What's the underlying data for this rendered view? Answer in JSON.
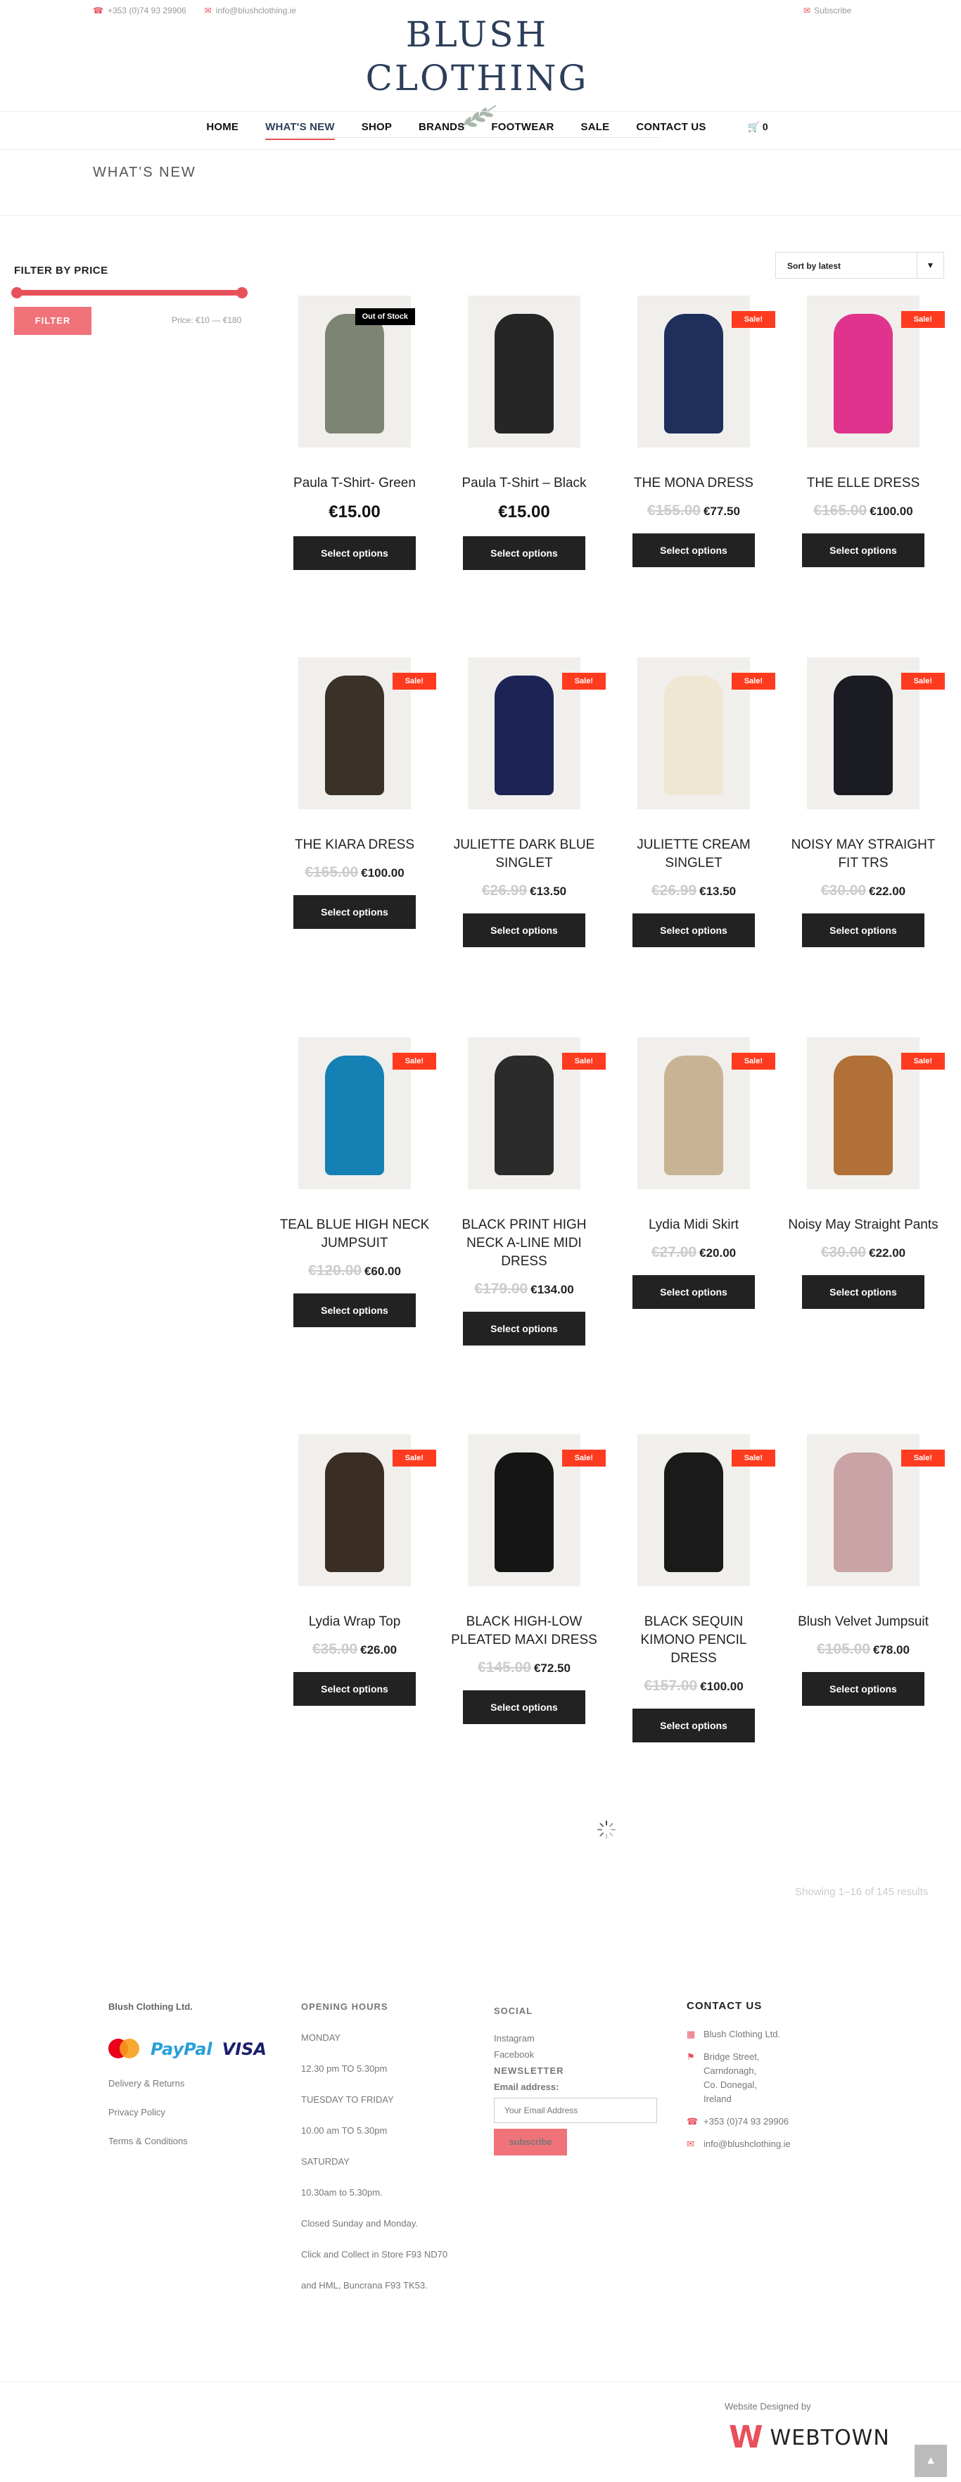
{
  "topbar": {
    "phone": "+353 (0)74 93 29906",
    "email": "info@blushclothing.ie",
    "subscribe": "Subscribe"
  },
  "logo": {
    "brand": "BLUSH CLOTHING"
  },
  "nav": {
    "items": [
      "HOME",
      "WHAT'S NEW",
      "SHOP",
      "BRANDS",
      "FOOTWEAR",
      "SALE",
      "CONTACT US"
    ],
    "active": "WHAT'S NEW",
    "cart_count": "0"
  },
  "page_title": "WHAT'S NEW",
  "filter": {
    "heading": "FILTER BY PRICE",
    "button": "FILTER",
    "range": "Price: €10 — €180",
    "min_fraction": 0,
    "max_fraction": 1
  },
  "sort": {
    "selected": "Sort by latest"
  },
  "products": [
    {
      "name": "Paula T-Shirt- Green",
      "old": "",
      "price": "€15.00",
      "badge": "Out of Stock",
      "button": "Select options",
      "color": "#7d8471"
    },
    {
      "name": "Paula T-Shirt – Black",
      "old": "",
      "price": "€15.00",
      "badge": "",
      "button": "Select options",
      "color": "#262626"
    },
    {
      "name": "THE MONA DRESS",
      "old": "€155.00",
      "price": "€77.50",
      "badge": "Sale!",
      "button": "Select options",
      "color": "#1f2f5c"
    },
    {
      "name": "THE ELLE DRESS",
      "old": "€165.00",
      "price": "€100.00",
      "badge": "Sale!",
      "button": "Select options",
      "color": "#e0338d"
    },
    {
      "name": "THE KIARA DRESS",
      "old": "€165.00",
      "price": "€100.00",
      "badge": "Sale!",
      "button": "Select options",
      "color": "#3a3128"
    },
    {
      "name": "JULIETTE DARK BLUE SINGLET",
      "old": "€26.99",
      "price": "€13.50",
      "badge": "Sale!",
      "button": "Select options",
      "color": "#1c2455"
    },
    {
      "name": "JULIETTE CREAM SINGLET",
      "old": "€26.99",
      "price": "€13.50",
      "badge": "Sale!",
      "button": "Select options",
      "color": "#efe7d2"
    },
    {
      "name": "NOISY MAY STRAIGHT FIT TRS",
      "old": "€30.00",
      "price": "€22.00",
      "badge": "Sale!",
      "button": "Select options",
      "color": "#1b1b24"
    },
    {
      "name": "TEAL BLUE HIGH NECK JUMPSUIT",
      "old": "€120.00",
      "price": "€60.00",
      "badge": "Sale!",
      "button": "Select options",
      "color": "#1580b3"
    },
    {
      "name": "BLACK PRINT HIGH NECK A-LINE MIDI DRESS",
      "old": "€179.00",
      "price": "€134.00",
      "badge": "Sale!",
      "button": "Select options",
      "color": "#2b2b2b"
    },
    {
      "name": "Lydia Midi Skirt",
      "old": "€27.00",
      "price": "€20.00",
      "badge": "Sale!",
      "button": "Select options",
      "color": "#c8b394"
    },
    {
      "name": "Noisy May Straight Pants",
      "old": "€30.00",
      "price": "€22.00",
      "badge": "Sale!",
      "button": "Select options",
      "color": "#b07037"
    },
    {
      "name": "Lydia Wrap Top",
      "old": "€35.00",
      "price": "€26.00",
      "badge": "Sale!",
      "button": "Select options",
      "color": "#3a2d24"
    },
    {
      "name": "BLACK HIGH-LOW PLEATED MAXI DRESS",
      "old": "€145.00",
      "price": "€72.50",
      "badge": "Sale!",
      "button": "Select options",
      "color": "#151515"
    },
    {
      "name": "BLACK SEQUIN KIMONO PENCIL DRESS",
      "old": "€157.00",
      "price": "€100.00",
      "badge": "Sale!",
      "button": "Select options",
      "color": "#1a1a1a"
    },
    {
      "name": "Blush Velvet Jumpsuit",
      "old": "€105.00",
      "price": "€78.00",
      "badge": "Sale!",
      "button": "Select options",
      "color": "#c9a3a6"
    }
  ],
  "results": "Showing 1–16 of 145 results",
  "footer": {
    "company": "Blush Clothing Ltd.",
    "payments": [
      "PayPal",
      "VISA"
    ],
    "links": [
      "Delivery & Returns",
      "Privacy Policy",
      "Terms & Conditions"
    ],
    "hours_heading": "OPENING HOURS",
    "hours": [
      "MONDAY",
      "12.30 pm TO 5.30pm",
      "TUESDAY TO FRIDAY",
      "10.00 am TO 5.30pm",
      "SATURDAY",
      "10.30am to 5.30pm.",
      "Closed Sunday and Monday.",
      "Click and Collect in Store F93 ND70",
      "and HML, Buncrana F93 TK53."
    ],
    "social_heading": "SOCIAL",
    "social": [
      "Instagram",
      "Facebook"
    ],
    "newsletter_heading": "NEWSLETTER",
    "email_label": "Email address:",
    "email_placeholder": "Your Email Address",
    "subscribe_button": "subscribe",
    "contact_heading": "CONTACT US",
    "contact_company": "Blush Clothing Ltd.",
    "address": [
      "Bridge Street,",
      "Carndonagh,",
      "Co. Donegal,",
      "Ireland"
    ],
    "phone": "+353 (0)74 93 29906",
    "email": "info@blushclothing.ie",
    "designed_by": "Website Designed by",
    "webtown": "WEBTOWN"
  },
  "colors": {
    "accent": "#e8505b",
    "sale_badge": "#ff3b1f",
    "button": "#222222",
    "brand_navy": "#2c3e5a"
  }
}
